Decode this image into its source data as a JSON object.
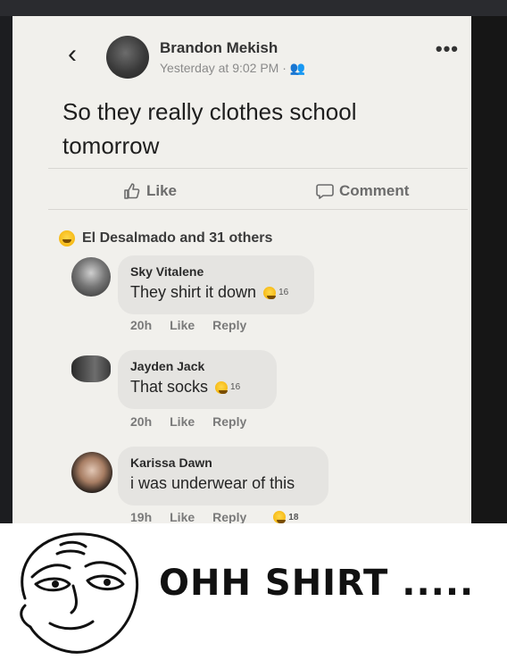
{
  "post": {
    "author": "Brandon Mekish",
    "time": "Yesterday at 9:02 PM · 👥",
    "text": "So they really clothes school tomorrow",
    "actions": {
      "like": "Like",
      "comment": "Comment"
    },
    "reactions": "El Desalmado and 31 others"
  },
  "comments": [
    {
      "name": "Sky Vitalene",
      "text": "They shirt it down",
      "count": "16",
      "time": "20h",
      "like": "Like",
      "reply": "Reply"
    },
    {
      "name": "Jayden Jack",
      "text": "That socks",
      "count": "16",
      "time": "20h",
      "like": "Like",
      "reply": "Reply"
    },
    {
      "name": "Karissa Dawn",
      "text": "i was underwear of this",
      "count": "18",
      "time": "19h",
      "like": "Like",
      "reply": "Reply"
    }
  ],
  "meme": {
    "caption": "OHH SHIRT ....."
  },
  "colors": {
    "background": "#1c1d20",
    "post": "#f1f0ec",
    "bubble": "#e5e4e1",
    "reaction": "#f5b50e"
  }
}
